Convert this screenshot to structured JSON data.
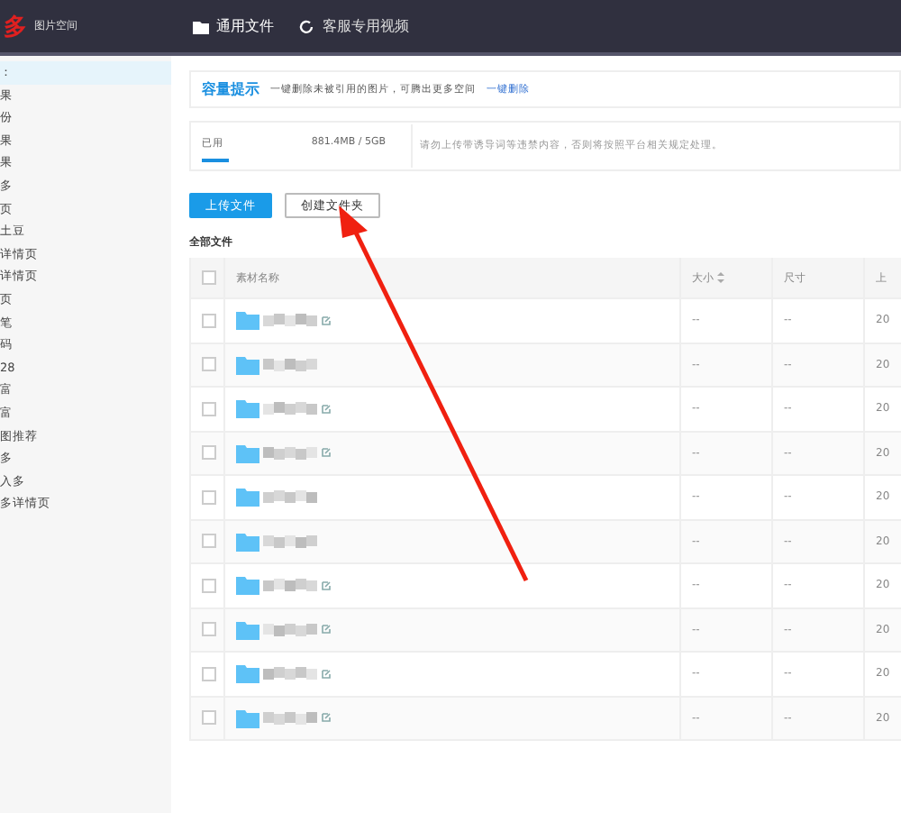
{
  "header": {
    "logo": "多",
    "subtitle": "图片空间",
    "nav": [
      {
        "label": "通用文件",
        "selected": true
      },
      {
        "label": "客服专用视频",
        "selected": false
      }
    ]
  },
  "sidebar": {
    "items": [
      {
        "label": "：",
        "selected": true
      },
      {
        "label": "果",
        "selected": false
      },
      {
        "label": "份",
        "selected": false
      },
      {
        "label": "果",
        "selected": false
      },
      {
        "label": "果",
        "selected": false
      },
      {
        "label": "多",
        "selected": false
      },
      {
        "label": "页",
        "selected": false
      },
      {
        "label": "土豆",
        "selected": false
      },
      {
        "label": "详情页",
        "selected": false
      },
      {
        "label": "详情页",
        "selected": false
      },
      {
        "label": "页",
        "selected": false
      },
      {
        "label": "笔",
        "selected": false
      },
      {
        "label": "码",
        "selected": false
      },
      {
        "label": "28",
        "selected": false
      },
      {
        "label": "富",
        "selected": false
      },
      {
        "label": "富",
        "selected": false
      },
      {
        "label": "图推荐",
        "selected": false
      },
      {
        "label": "多",
        "selected": false
      },
      {
        "label": "入多",
        "selected": false
      },
      {
        "label": "多详情页",
        "selected": false
      }
    ]
  },
  "capacity": {
    "title": "容量提示",
    "text": "一键删除未被引用的图片，可腾出更多空间",
    "link": "一键删除",
    "used_label": "已用",
    "used_value": "881.4MB / 5GB",
    "notice": "请勿上传带诱导词等违禁内容，否则将按照平台相关规定处理。"
  },
  "buttons": [
    {
      "label": "上传文件",
      "kind": "primary"
    },
    {
      "label": "创建文件夹",
      "kind": "default"
    }
  ],
  "section_title": "全部文件",
  "table": {
    "select_all_checked": false,
    "columns": [
      {
        "label": "素材名称",
        "sortable": false
      },
      {
        "label": "大小",
        "sortable": true
      },
      {
        "label": "尺寸",
        "sortable": false
      },
      {
        "label": "上",
        "sortable": false
      }
    ],
    "rows": [
      {
        "checked": false,
        "editable": true,
        "size": "--",
        "dimensions": "--",
        "column_4": "20"
      },
      {
        "checked": false,
        "editable": false,
        "size": "--",
        "dimensions": "--",
        "column_4": "20"
      },
      {
        "checked": false,
        "editable": true,
        "size": "--",
        "dimensions": "--",
        "column_4": "20"
      },
      {
        "checked": false,
        "editable": true,
        "size": "--",
        "dimensions": "--",
        "column_4": "20"
      },
      {
        "checked": false,
        "editable": false,
        "size": "--",
        "dimensions": "--",
        "column_4": "20"
      },
      {
        "checked": false,
        "editable": false,
        "size": "--",
        "dimensions": "--",
        "column_4": "20"
      },
      {
        "checked": false,
        "editable": true,
        "size": "--",
        "dimensions": "--",
        "column_4": "20"
      },
      {
        "checked": false,
        "editable": true,
        "size": "--",
        "dimensions": "--",
        "column_4": "20"
      },
      {
        "checked": false,
        "editable": true,
        "size": "--",
        "dimensions": "--",
        "column_4": "20"
      },
      {
        "checked": false,
        "editable": true,
        "size": "--",
        "dimensions": "--",
        "column_4": "20"
      }
    ]
  }
}
